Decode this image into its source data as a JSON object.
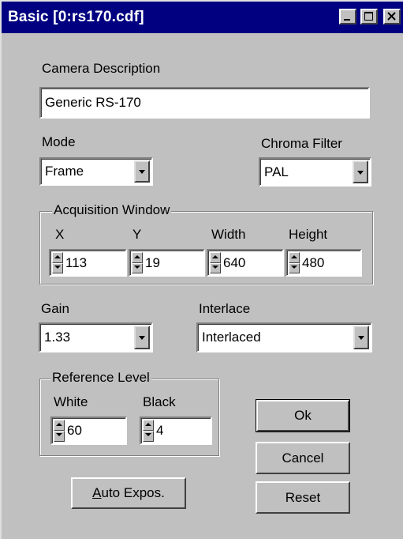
{
  "window": {
    "title": "Basic [0:rs170.cdf]"
  },
  "camera_description": {
    "label": "Camera Description",
    "value": "Generic RS-170"
  },
  "mode": {
    "label": "Mode",
    "value": "Frame"
  },
  "chroma_filter": {
    "label": "Chroma Filter",
    "value": "PAL"
  },
  "acquisition_window": {
    "label": "Acquisition Window",
    "x_label": "X",
    "x_value": "113",
    "y_label": "Y",
    "y_value": "19",
    "width_label": "Width",
    "width_value": "640",
    "height_label": "Height",
    "height_value": "480"
  },
  "gain": {
    "label": "Gain",
    "value": "1.33"
  },
  "interlace": {
    "label": "Interlace",
    "value": "Interlaced"
  },
  "reference_level": {
    "label": "Reference Level",
    "white_label": "White",
    "white_value": "60",
    "black_label": "Black",
    "black_value": "4"
  },
  "buttons": {
    "ok": "Ok",
    "cancel": "Cancel",
    "reset": "Reset",
    "auto_expos_mnemonic": "A",
    "auto_expos_rest": "uto Expos."
  },
  "colors": {
    "titlebar": "#000080",
    "face": "#c0c0c0"
  }
}
